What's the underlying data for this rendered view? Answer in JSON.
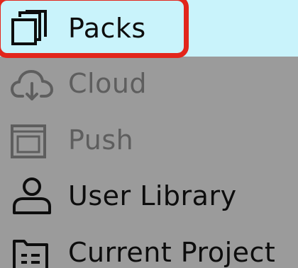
{
  "sidebar": {
    "items": [
      {
        "label": "Packs",
        "icon": "stacked-windows-icon",
        "state": "selected"
      },
      {
        "label": "Cloud",
        "icon": "cloud-download-icon",
        "state": "dim"
      },
      {
        "label": "Push",
        "icon": "push-device-icon",
        "state": "dim"
      },
      {
        "label": "User Library",
        "icon": "user-icon",
        "state": "normal"
      },
      {
        "label": "Current Project",
        "icon": "project-folder-icon",
        "state": "normal"
      }
    ]
  },
  "colors": {
    "background": "#9b9b9b",
    "selected_background": "#c9f3fb",
    "highlight_ring": "#e2261c",
    "text_normal": "#0d0d0d",
    "text_dim": "#5e5e5e"
  }
}
